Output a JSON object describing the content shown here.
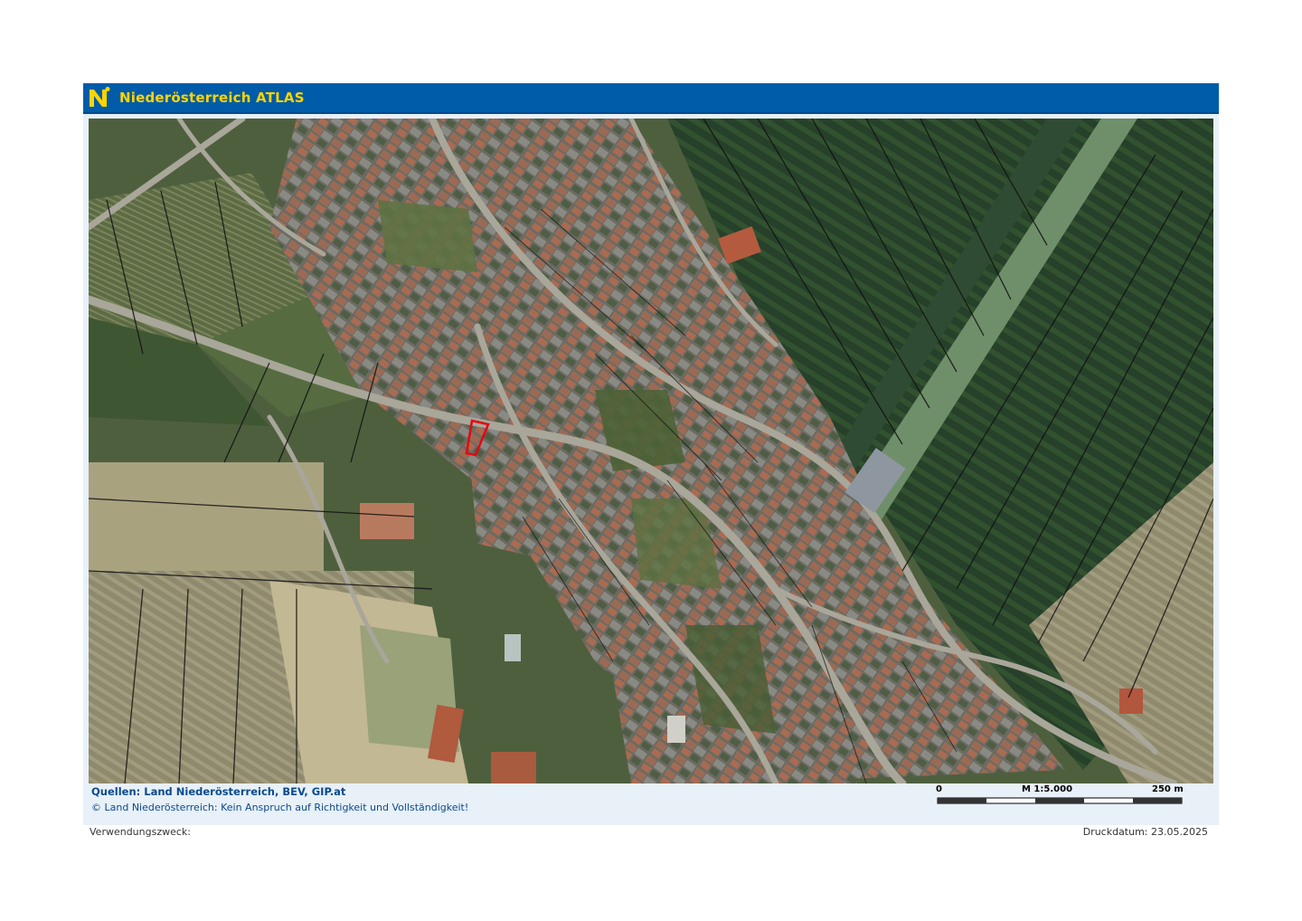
{
  "header": {
    "title": "Niederösterreich ATLAS"
  },
  "footer": {
    "sources": "Quellen: Land Niederösterreich, BEV, GIP.at",
    "copyright": "© Land Niederösterreich: Kein Anspruch auf Richtigkeit und Vollständigkeit!"
  },
  "scale": {
    "start_label": "0",
    "scale_label": "M 1:5.000",
    "end_label": "250 m"
  },
  "meta": {
    "purpose_label": "Verwendungszweck:",
    "print_date": "Druckdatum: 23.05.2025"
  },
  "colors": {
    "header_bg": "#005ca9",
    "header_text": "#ffd400",
    "footer_bg": "#e8f0f8",
    "footer_text": "#0a4a8c",
    "highlight_parcel": "#e30613",
    "parcel_lines": "#111111"
  }
}
